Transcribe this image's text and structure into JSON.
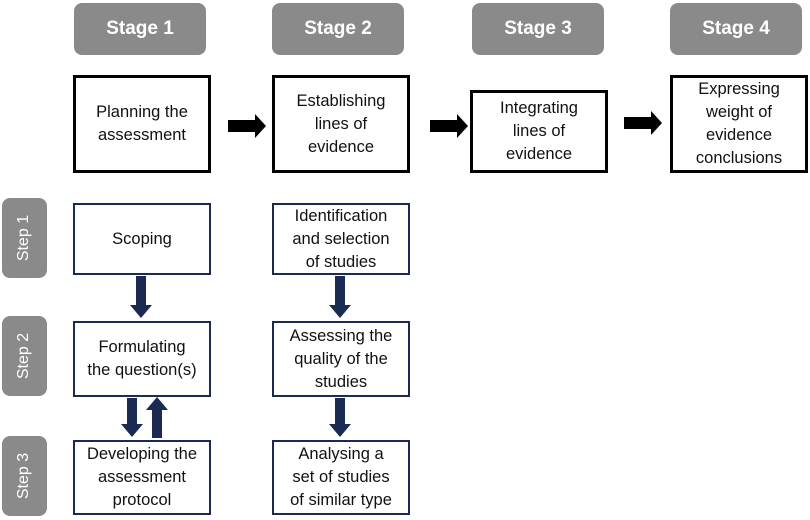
{
  "stages": [
    {
      "label": "Stage 1",
      "box": "Planning the\nassessment"
    },
    {
      "label": "Stage 2",
      "box": "Establishing\nlines of\nevidence"
    },
    {
      "label": "Stage 3",
      "box": "Integrating\nlines of\nevidence"
    },
    {
      "label": "Stage 4",
      "box": "Expressing\nweight of\nevidence\nconclusions"
    }
  ],
  "steps": [
    {
      "label": "Step 1"
    },
    {
      "label": "Step 2"
    },
    {
      "label": "Step 3"
    }
  ],
  "stage1_steps": [
    "Scoping",
    "Formulating\nthe question(s)",
    "Developing the\nassessment\nprotocol"
  ],
  "stage2_steps": [
    "Identification\nand selection\nof studies",
    "Assessing the\nquality of the\nstudies",
    "Analysing a\nset of studies\nof similar type"
  ],
  "colors": {
    "pill": "#8a8a8a",
    "step_border": "#1b2a52",
    "arrow_main": "#000000",
    "arrow_step": "#1b2a52"
  }
}
